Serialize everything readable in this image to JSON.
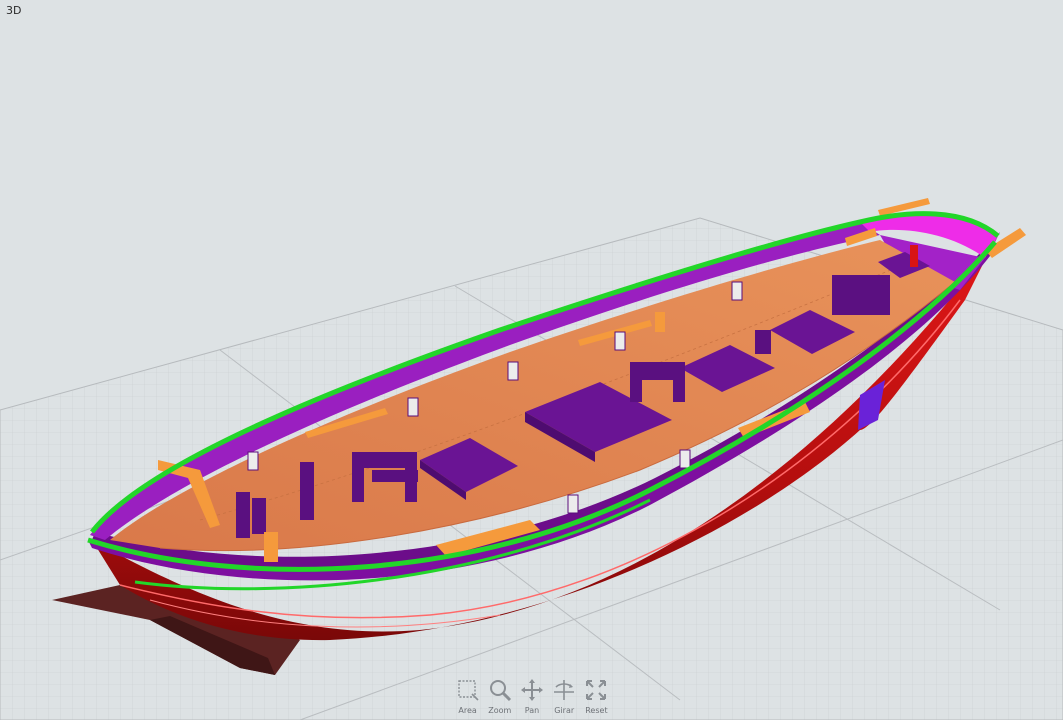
{
  "viewport": {
    "label": "3D",
    "colors": {
      "background": "#dde2e4",
      "grid": "#c2c6c9",
      "hull_red": "#d81414",
      "hull_dark": "#8a0b0b",
      "keel": "#5b2322",
      "bulwark": "#7e0fa0",
      "bulwark_light": "#b12ad0",
      "magenta": "#ee2ce8",
      "deck": "#e0844e",
      "rail": "#22d629",
      "fittings": "#f59a3c",
      "deck_structures": "#6a1494"
    }
  },
  "toolbar": {
    "items": [
      {
        "id": "area",
        "label": "Area",
        "icon": "area-select-icon"
      },
      {
        "id": "zoom",
        "label": "Zoom",
        "icon": "zoom-icon"
      },
      {
        "id": "pan",
        "label": "Pan",
        "icon": "pan-arrows-icon"
      },
      {
        "id": "rotate",
        "label": "Girar",
        "icon": "rotate-icon"
      },
      {
        "id": "reset",
        "label": "Reset",
        "icon": "reset-icon"
      }
    ]
  }
}
